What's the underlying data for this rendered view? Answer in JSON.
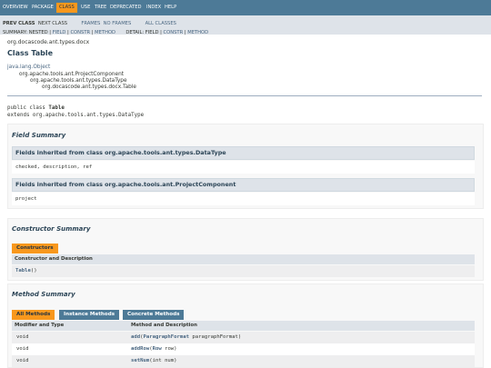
{
  "topnav": {
    "items": [
      "Overview",
      "Package",
      "Class",
      "Use",
      "Tree",
      "Deprecated",
      "Index",
      "Help"
    ],
    "active": "Class"
  },
  "subnav": {
    "prev_class": "Prev Class",
    "next_class": "Next Class",
    "frames": "Frames",
    "no_frames": "No Frames",
    "all_classes": "All Classes",
    "summary_label": "Summary:",
    "summary_nested": "Nested",
    "summary_field": "Field",
    "summary_constr": "Constr",
    "summary_method": "Method",
    "detail_label": "Detail:",
    "detail_field": "Field",
    "detail_constr": "Constr",
    "detail_method": "Method"
  },
  "package_name": "org.docascode.ant.types.docx",
  "class_title": "Class Table",
  "inheritance": [
    "java.lang.Object",
    "org.apache.tools.ant.ProjectComponent",
    "org.apache.tools.ant.types.DataType",
    "org.docascode.ant.types.docx.Table"
  ],
  "declaration": {
    "line1_prefix": "public class ",
    "line1_name": "Table",
    "line2": "extends org.apache.tools.ant.types.DataType"
  },
  "field_summary": {
    "title": "Field Summary",
    "inherited": [
      {
        "heading": "Fields inherited from class org.apache.tools.ant.types.DataType",
        "list": "checked, description, ref"
      },
      {
        "heading": "Fields inherited from class org.apache.tools.ant.ProjectComponent",
        "list": "project"
      }
    ]
  },
  "constructor_summary": {
    "title": "Constructor Summary",
    "tab": "Constructors",
    "column": "Constructor and Description",
    "rows": [
      {
        "name": "Table",
        "params": "()"
      }
    ]
  },
  "method_summary": {
    "title": "Method Summary",
    "tabs": [
      "All Methods",
      "Instance Methods",
      "Concrete Methods"
    ],
    "col_modifier": "Modifier and Type",
    "col_method": "Method and Description",
    "rows": [
      {
        "modifier": "void",
        "name": "add",
        "param_type": "ParagraphFormat",
        "param_rest": " paragraphFormat)"
      },
      {
        "modifier": "void",
        "name": "addRow",
        "param_type": "Row",
        "param_rest": " row)"
      },
      {
        "modifier": "void",
        "name": "setNum",
        "param_type": "",
        "param_rest": "int num)"
      }
    ]
  },
  "colors": {
    "nav_bg": "#4d7a97",
    "nav_active": "#f8981d",
    "subnav_bg": "#dee3e9",
    "heading": "#2c4557",
    "link": "#4a6782"
  }
}
